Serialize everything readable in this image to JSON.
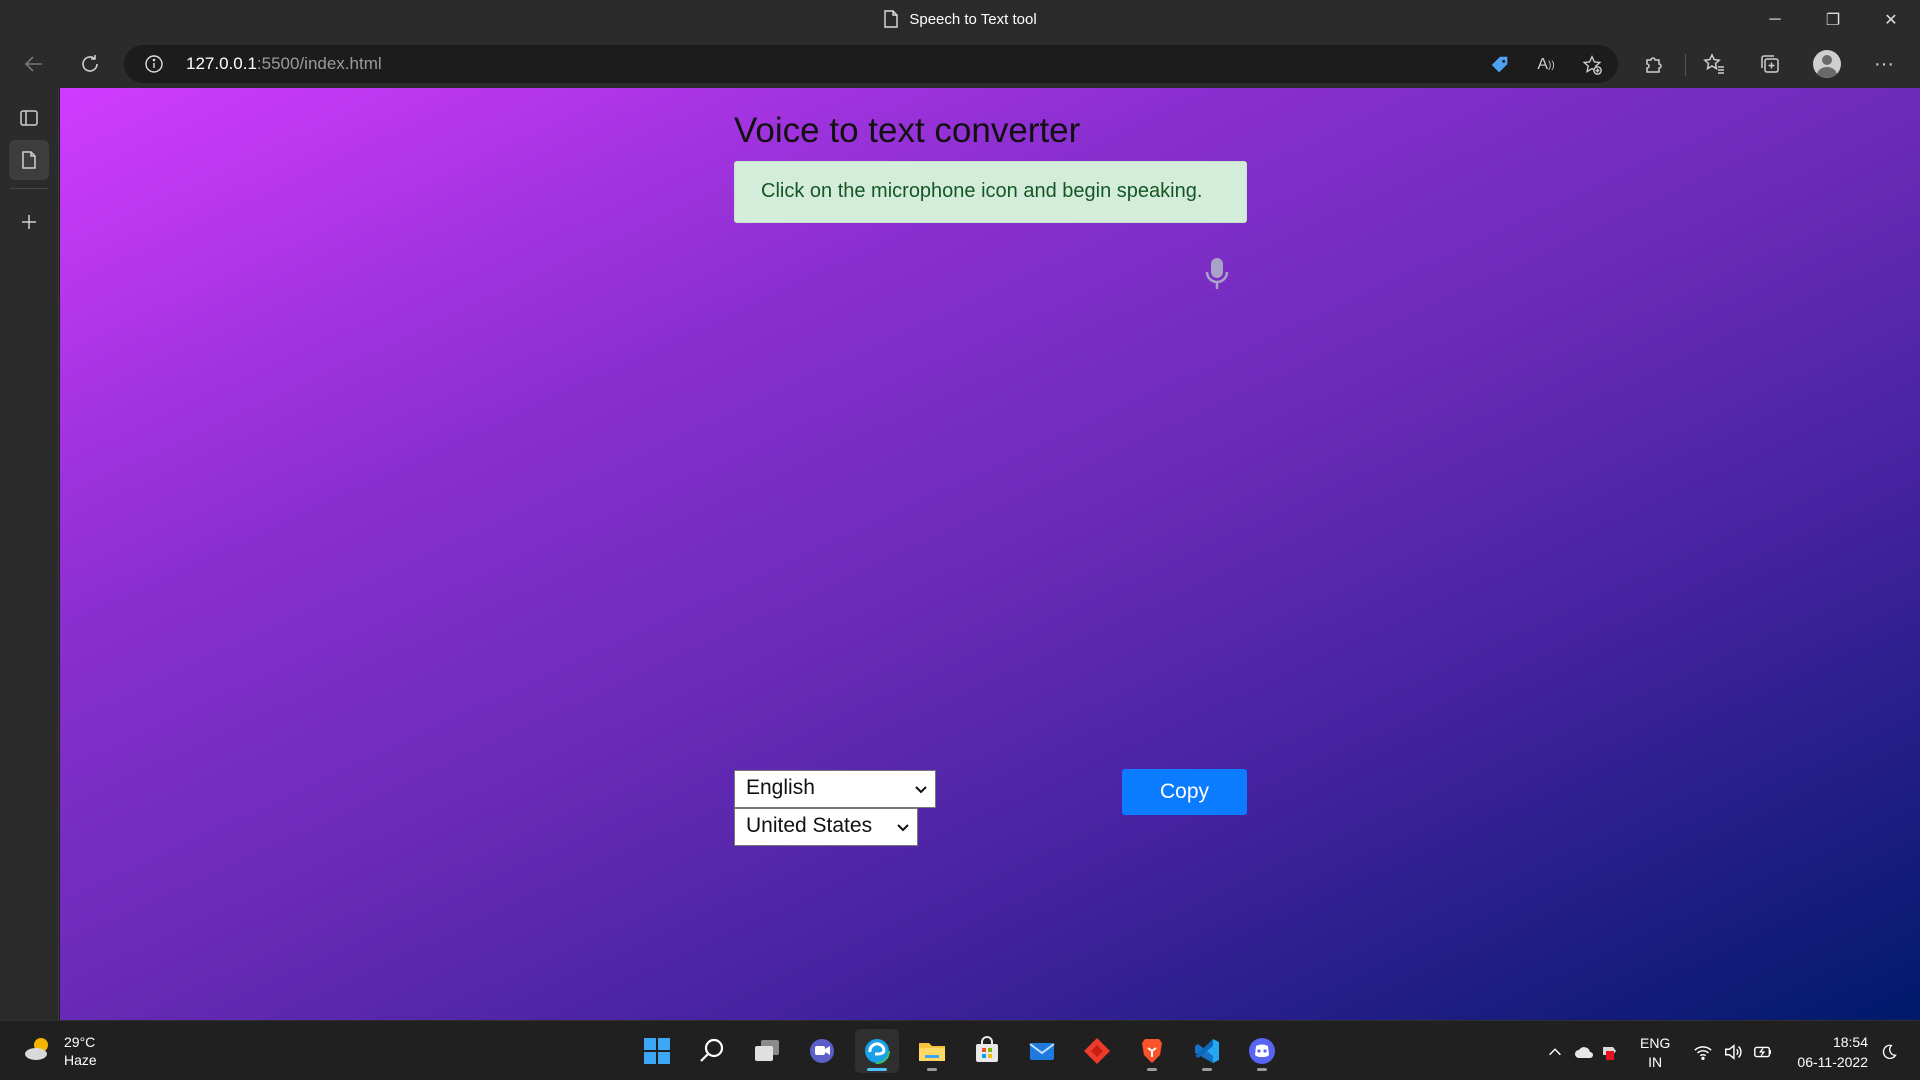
{
  "window": {
    "title": "Speech to Text tool",
    "controls": {
      "minimize": "─",
      "restore": "❐",
      "close": "✕"
    }
  },
  "toolbar": {
    "url_host": "127.0.0.1",
    "url_path": ":5500/index.html"
  },
  "page": {
    "heading": "Voice to text converter",
    "alert": "Click on the microphone icon and begin speaking.",
    "language_select": "English",
    "dialect_select": "United States",
    "copy_button": "Copy",
    "colors": {
      "alert_bg": "#d4edda",
      "alert_text": "#155724",
      "copy_bg": "#0b7bff"
    }
  },
  "taskbar": {
    "weather_temp": "29°C",
    "weather_desc": "Haze",
    "lang_top": "ENG",
    "lang_bottom": "IN",
    "time": "18:54",
    "date": "06-11-2022"
  }
}
